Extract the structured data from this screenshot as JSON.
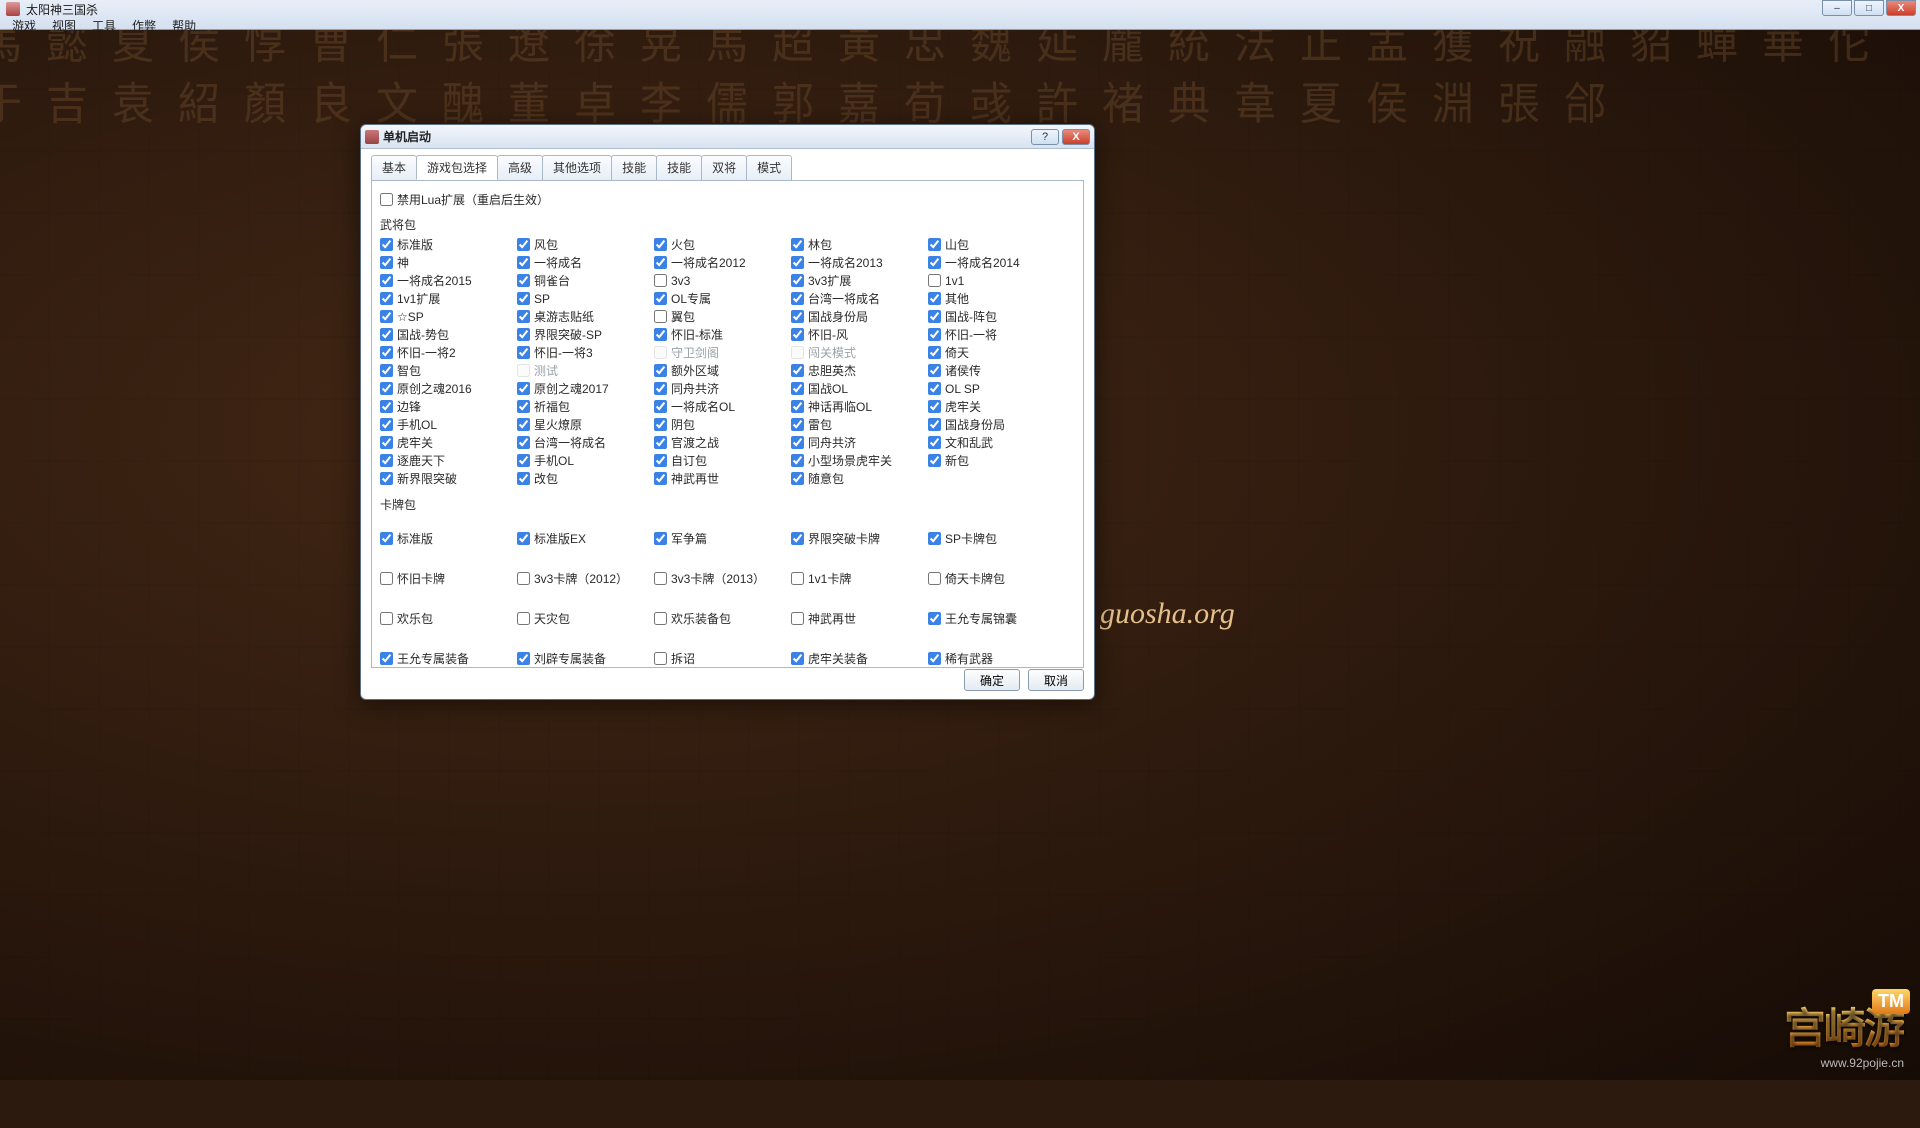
{
  "chrome": {
    "title": "太阳神三国杀",
    "menus": [
      "游戏",
      "视图",
      "工具",
      "作弊",
      "帮助"
    ],
    "min": "–",
    "max": "□",
    "close": "X"
  },
  "dialog": {
    "title": "单机启动",
    "help": "?",
    "close": "X",
    "tabs": [
      "基本",
      "游戏包选择",
      "高级",
      "其他选项",
      "技能",
      "技能",
      "双将",
      "模式"
    ],
    "active_tab": 1,
    "top_check": {
      "label": "禁用Lua扩展（重启后生效）",
      "checked": false
    },
    "section1": "武将包",
    "generals": [
      {
        "label": "标准版",
        "checked": true
      },
      {
        "label": "风包",
        "checked": true
      },
      {
        "label": "火包",
        "checked": true
      },
      {
        "label": "林包",
        "checked": true
      },
      {
        "label": "山包",
        "checked": true
      },
      {
        "label": "神",
        "checked": true
      },
      {
        "label": "一将成名",
        "checked": true
      },
      {
        "label": "一将成名2012",
        "checked": true
      },
      {
        "label": "一将成名2013",
        "checked": true
      },
      {
        "label": "一将成名2014",
        "checked": true
      },
      {
        "label": "一将成名2015",
        "checked": true
      },
      {
        "label": "铜雀台",
        "checked": true
      },
      {
        "label": "3v3",
        "checked": false
      },
      {
        "label": "3v3扩展",
        "checked": true
      },
      {
        "label": "1v1",
        "checked": false
      },
      {
        "label": "1v1扩展",
        "checked": true
      },
      {
        "label": "SP",
        "checked": true
      },
      {
        "label": "OL专属",
        "checked": true
      },
      {
        "label": "台湾一将成名",
        "checked": true
      },
      {
        "label": "其他",
        "checked": true
      },
      {
        "label": "☆SP",
        "checked": true
      },
      {
        "label": "桌游志贴纸",
        "checked": true
      },
      {
        "label": "翼包",
        "checked": false
      },
      {
        "label": "国战身份局",
        "checked": true
      },
      {
        "label": "国战-阵包",
        "checked": true
      },
      {
        "label": "国战-势包",
        "checked": true
      },
      {
        "label": "界限突破-SP",
        "checked": true
      },
      {
        "label": "怀旧-标准",
        "checked": true
      },
      {
        "label": "怀旧-风",
        "checked": true
      },
      {
        "label": "怀旧-一将",
        "checked": true
      },
      {
        "label": "怀旧-一将2",
        "checked": true
      },
      {
        "label": "怀旧-一将3",
        "checked": true
      },
      {
        "label": "守卫剑阁",
        "checked": false,
        "disabled": true
      },
      {
        "label": "闯关模式",
        "checked": false,
        "disabled": true
      },
      {
        "label": "倚天",
        "checked": true
      },
      {
        "label": "智包",
        "checked": true
      },
      {
        "label": "测试",
        "checked": false,
        "disabled": true
      },
      {
        "label": "额外区域",
        "checked": true
      },
      {
        "label": "忠胆英杰",
        "checked": true
      },
      {
        "label": "诸侯传",
        "checked": true
      },
      {
        "label": "原创之魂2016",
        "checked": true
      },
      {
        "label": "原创之魂2017",
        "checked": true
      },
      {
        "label": "同舟共济",
        "checked": true
      },
      {
        "label": "国战OL",
        "checked": true
      },
      {
        "label": "OL SP",
        "checked": true
      },
      {
        "label": "边锋",
        "checked": true
      },
      {
        "label": "祈福包",
        "checked": true
      },
      {
        "label": "一将成名OL",
        "checked": true
      },
      {
        "label": "神话再临OL",
        "checked": true
      },
      {
        "label": "虎牢关",
        "checked": true
      },
      {
        "label": "手机OL",
        "checked": true
      },
      {
        "label": "星火燎原",
        "checked": true
      },
      {
        "label": "阴包",
        "checked": true
      },
      {
        "label": "雷包",
        "checked": true
      },
      {
        "label": "国战身份局",
        "checked": true
      },
      {
        "label": "虎牢关",
        "checked": true
      },
      {
        "label": "台湾一将成名",
        "checked": true
      },
      {
        "label": "官渡之战",
        "checked": true
      },
      {
        "label": "同舟共济",
        "checked": true
      },
      {
        "label": "文和乱武",
        "checked": true
      },
      {
        "label": "逐鹿天下",
        "checked": true
      },
      {
        "label": "手机OL",
        "checked": true
      },
      {
        "label": "自订包",
        "checked": true
      },
      {
        "label": "小型场景虎牢关",
        "checked": true
      },
      {
        "label": "新包",
        "checked": true
      },
      {
        "label": "新界限突破",
        "checked": true
      },
      {
        "label": "改包",
        "checked": true
      },
      {
        "label": "神武再世",
        "checked": true
      },
      {
        "label": "随意包",
        "checked": true
      }
    ],
    "section2": "卡牌包",
    "cards": [
      {
        "label": "标准版",
        "checked": true
      },
      {
        "label": "标准版EX",
        "checked": true
      },
      {
        "label": "军争篇",
        "checked": true
      },
      {
        "label": "界限突破卡牌",
        "checked": true
      },
      {
        "label": "SP卡牌包",
        "checked": true
      },
      {
        "label": "怀旧卡牌",
        "checked": false
      },
      {
        "label": "3v3卡牌（2012）",
        "checked": false
      },
      {
        "label": "3v3卡牌（2013）",
        "checked": false
      },
      {
        "label": "1v1卡牌",
        "checked": false
      },
      {
        "label": "倚天卡牌包",
        "checked": false
      },
      {
        "label": "欢乐包",
        "checked": false
      },
      {
        "label": "天灾包",
        "checked": false
      },
      {
        "label": "欢乐装备包",
        "checked": false
      },
      {
        "label": "神武再世",
        "checked": false
      },
      {
        "label": "王允专属锦囊",
        "checked": true
      },
      {
        "label": "王允专属装备",
        "checked": true
      },
      {
        "label": "刘辟专属装备",
        "checked": true
      },
      {
        "label": "拆诏",
        "checked": false
      },
      {
        "label": "虎牢关装备",
        "checked": true
      },
      {
        "label": "稀有武器",
        "checked": true
      }
    ],
    "ok": "确定",
    "cancel": "取消"
  },
  "watermark": "guosha.org",
  "banner": {
    "text": "宫崎游",
    "tag": "TM",
    "url": "www.92pojie.cn"
  }
}
